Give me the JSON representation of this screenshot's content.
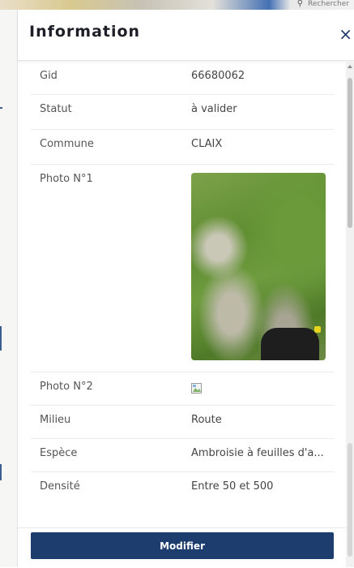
{
  "map": {
    "search_text": "Rechercher"
  },
  "panel": {
    "title": "Information",
    "close_icon": "×"
  },
  "fields": [
    {
      "label": "Gid",
      "value": "66680062"
    },
    {
      "label": "Statut",
      "value": "à valider"
    },
    {
      "label": "Commune",
      "value": "CLAIX"
    },
    {
      "label": "Photo N°1",
      "value_type": "image"
    },
    {
      "label": "Photo N°2",
      "value_type": "broken-image"
    },
    {
      "label": "Milieu",
      "value": "Route"
    },
    {
      "label": "Espèce",
      "value": "Ambroisie à feuilles d'a..."
    },
    {
      "label": "Densité",
      "value": "Entre 50 et 500"
    }
  ],
  "footer": {
    "modify_label": "Modifier"
  },
  "colors": {
    "primary": "#1c3d6e",
    "close_icon": "#1e3a6a"
  }
}
